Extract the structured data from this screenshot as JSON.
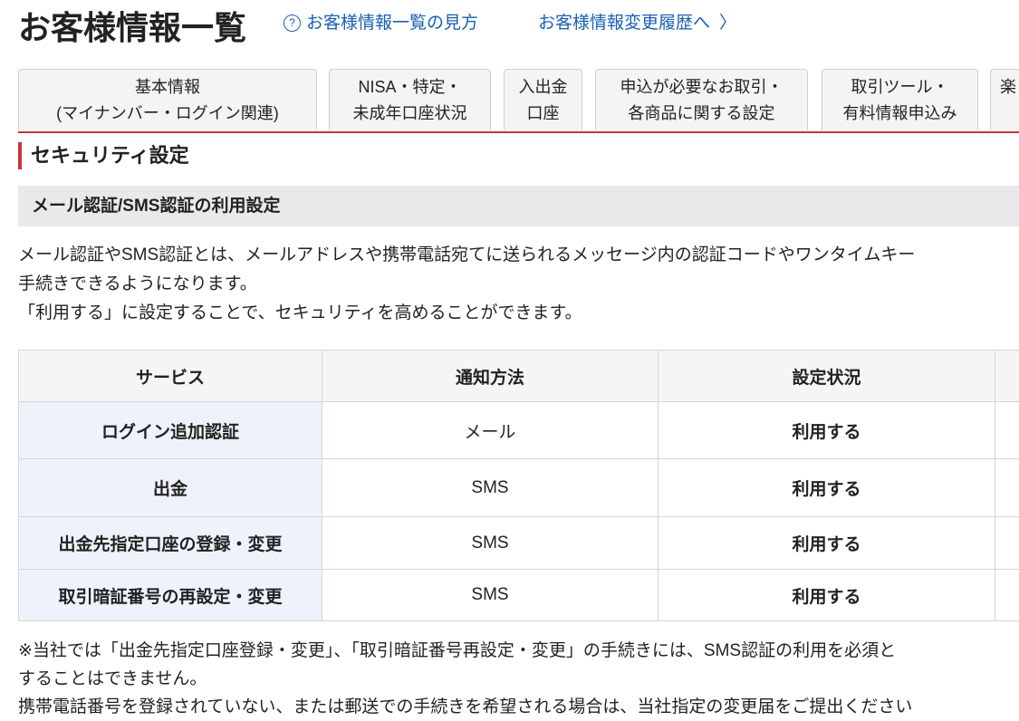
{
  "header": {
    "title": "お客様情報一覧",
    "help_link": "お客様情報一覧の見方",
    "history_link": "お客様情報変更履歴へ"
  },
  "tabs": [
    {
      "line1": "基本情報",
      "line2": "(マイナンバー・ログイン関連)"
    },
    {
      "line1": "NISA・特定・",
      "line2": "未成年口座状況"
    },
    {
      "line1": "入出金",
      "line2": "口座"
    },
    {
      "line1": "申込が必要なお取引・",
      "line2": "各商品に関する設定"
    },
    {
      "line1": "取引ツール・",
      "line2": "有料情報申込み"
    },
    {
      "line1": "楽",
      "line2": ""
    }
  ],
  "section": {
    "title": "セキュリティ設定",
    "subtitle": "メール認証/SMS認証の利用設定",
    "desc": [
      "メール認証やSMS認証とは、メールアドレスや携帯電話宛てに送られるメッセージ内の認証コードやワンタイムキー",
      "手続きできるようになります。",
      "「利用する」に設定することで、セキュリティを高めることができます。"
    ]
  },
  "table": {
    "headers": [
      "サービス",
      "通知方法",
      "設定状況"
    ],
    "rows": [
      [
        "ログイン追加認証",
        "メール",
        "利用する"
      ],
      [
        "出金",
        "SMS",
        "利用する"
      ],
      [
        "出金先指定口座の登録・変更",
        "SMS",
        "利用する"
      ],
      [
        "取引暗証番号の再設定・変更",
        "SMS",
        "利用する"
      ]
    ]
  },
  "footnotes": [
    "※当社では「出金先指定口座登録・変更」、「取引暗証番号再設定・変更」の手続きには、SMS認証の利用を必須と",
    "することはできません。",
    "携帯電話番号を登録されていない、または郵送での手続きを希望される場合は、当社指定の変更届をご提出ください"
  ]
}
